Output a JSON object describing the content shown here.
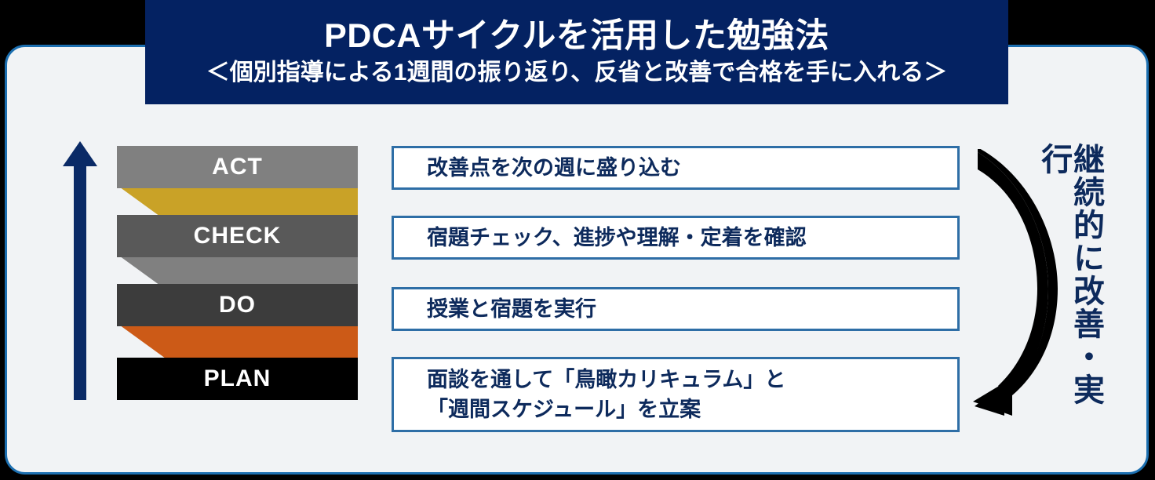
{
  "header": {
    "title": "PDCAサイクルを活用した勉強法",
    "subtitle": "＜個別指導による1週間の振り返り、反省と改善で合格を手に入れる＞",
    "background_color": "#042262",
    "text_color": "#FFFFFF"
  },
  "panel": {
    "background_color": "#F1F3F5",
    "border_color": "#1C6FB0",
    "outside_color": "#000000"
  },
  "left_arrow": {
    "name": "upward-progress-arrow",
    "direction": "up",
    "color": "#0A2A66"
  },
  "cycle": {
    "steps": [
      {
        "label": "ACT",
        "bar_color": "#808080",
        "connector_color": "#C9A227",
        "description": "改善点を次の週に盛り込む"
      },
      {
        "label": "CHECK",
        "bar_color": "#595959",
        "connector_color": "#808080",
        "description": "宿題チェック、進捗や理解・定着を確認"
      },
      {
        "label": "DO",
        "bar_color": "#3C3C3C",
        "connector_color": "#CC5A17",
        "description": "授業と宿題を実行"
      },
      {
        "label": "PLAN",
        "bar_color": "#000000",
        "connector_color": null,
        "description": "面談を通して「鳥瞰カリキュラム」と\n「週間スケジュール」を立案"
      }
    ],
    "box_border_color": "#2E6EA6",
    "box_text_color": "#0D2A5C"
  },
  "cycle_arrow": {
    "name": "continuous-improvement-arrow",
    "color": "#000000",
    "direction": "clockwise-down"
  },
  "vertical_label": {
    "text": "継続的に改善・実行",
    "color": "#0D2A5C",
    "orientation": "vertical"
  }
}
